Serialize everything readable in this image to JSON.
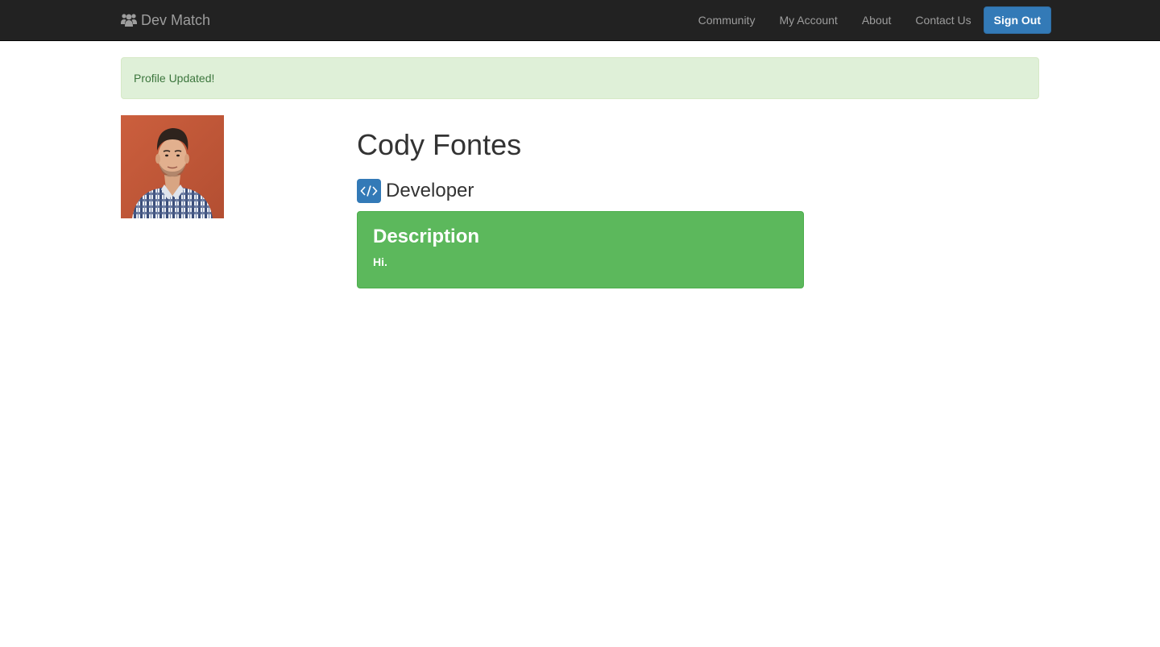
{
  "navbar": {
    "brand": "Dev Match",
    "brand_icon": "users-icon",
    "links": [
      {
        "label": "Community"
      },
      {
        "label": "My Account"
      },
      {
        "label": "About"
      },
      {
        "label": "Contact Us"
      }
    ],
    "signout_label": "Sign Out"
  },
  "alert": {
    "message": "Profile Updated!"
  },
  "profile": {
    "name": "Cody Fontes",
    "role": "Developer",
    "role_icon": "code-icon",
    "description": {
      "title": "Description",
      "text": "Hi."
    }
  },
  "colors": {
    "navbar_bg": "#222222",
    "primary": "#337ab7",
    "success": "#5cb85c",
    "alert_bg": "#dff0d8",
    "alert_text": "#3c763d"
  }
}
